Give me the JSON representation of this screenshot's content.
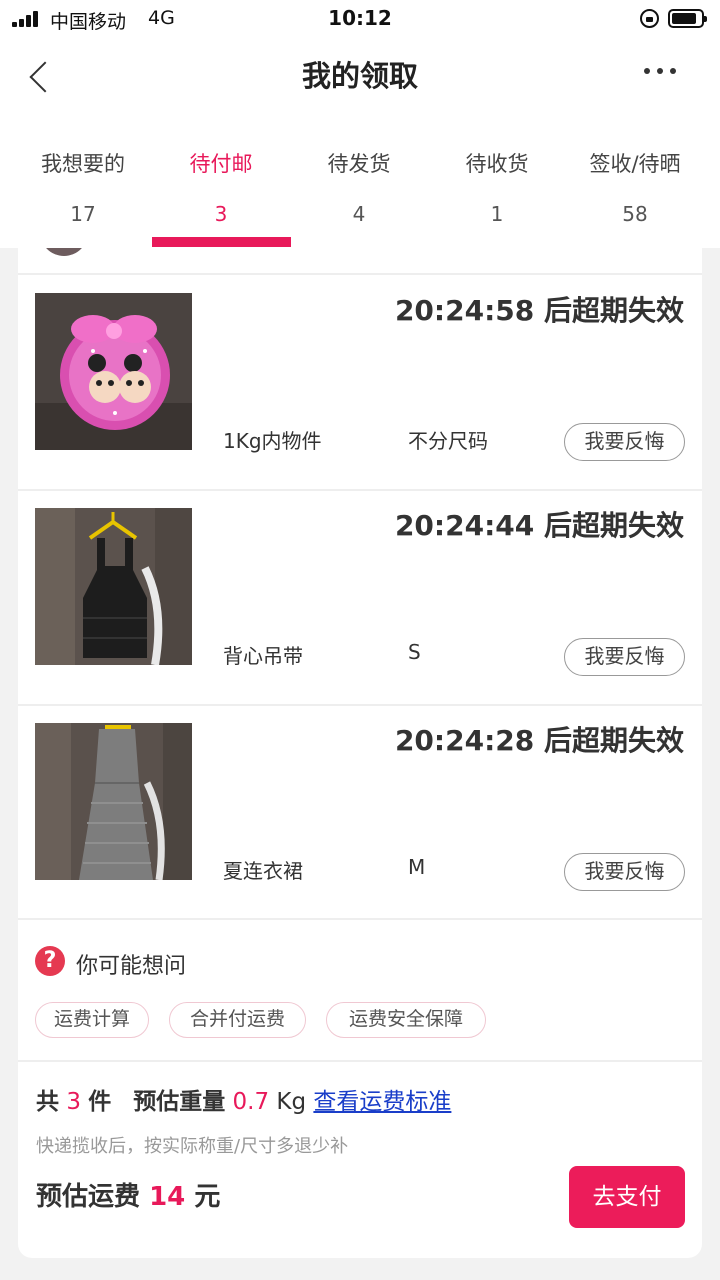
{
  "status_bar": {
    "carrier": "中国移动",
    "network": "4G",
    "time": "10:12"
  },
  "nav": {
    "title": "我的领取"
  },
  "tabs": [
    {
      "label": "我想要的",
      "count": "17"
    },
    {
      "label": "待付邮",
      "count": "3"
    },
    {
      "label": "待发货",
      "count": "4"
    },
    {
      "label": "待收货",
      "count": "1"
    },
    {
      "label": "签收/待晒",
      "count": "58"
    }
  ],
  "active_tab": "待付邮",
  "items": [
    {
      "countdown": "20:24:58 后超期失效",
      "name": "1Kg内物件",
      "size": "不分尺码",
      "action": "我要反悔"
    },
    {
      "countdown": "20:24:44 后超期失效",
      "name": "背心吊带",
      "size": "S",
      "action": "我要反悔"
    },
    {
      "countdown": "20:24:28 后超期失效",
      "name": "夏连衣裙",
      "size": "M",
      "action": "我要反悔"
    }
  ],
  "faq": {
    "title": "你可能想问",
    "chips": [
      "运费计算",
      "合并付运费",
      "运费安全保障"
    ]
  },
  "summary": {
    "total_prefix": "共",
    "total_count": "3",
    "total_suffix": "件",
    "weight_label": "预估重量",
    "weight_value": "0.7",
    "weight_unit": "Kg",
    "standard_link": "查看运费标准",
    "note": "快递揽收后，按实际称重/尺寸多退少补",
    "fee_label": "预估运费",
    "fee_value": "14",
    "fee_unit": "元",
    "pay_button": "去支付"
  },
  "colors": {
    "accent": "#e8195a",
    "link": "#1a3ec9",
    "pay_button": "#ec1c5a"
  }
}
